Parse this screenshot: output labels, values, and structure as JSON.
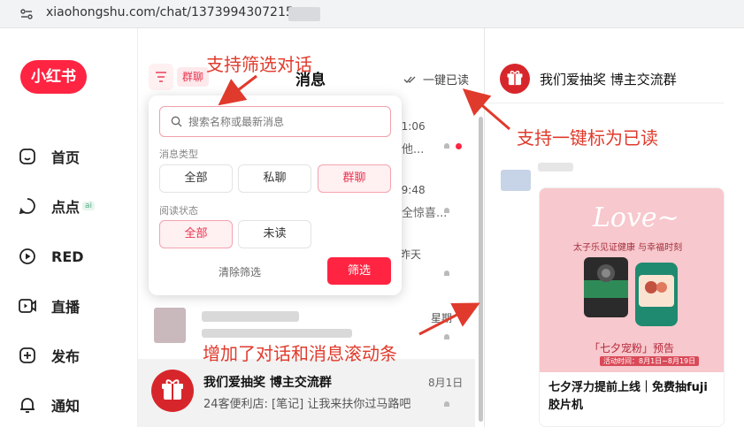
{
  "browser": {
    "url": "xiaohongshu.com/chat/1373994307215"
  },
  "brand": {
    "logo": "小红书",
    "accent": "#ff2442"
  },
  "nav": {
    "items": [
      {
        "label": "首页",
        "icon": "home-icon"
      },
      {
        "label": "点点",
        "icon": "chat-bubble-icon",
        "badge": "ai"
      },
      {
        "label": "RED",
        "icon": "play-icon"
      },
      {
        "label": "直播",
        "icon": "live-icon"
      },
      {
        "label": "发布",
        "icon": "plus-icon"
      },
      {
        "label": "通知",
        "icon": "bell-icon"
      }
    ]
  },
  "messages": {
    "title": "消息",
    "active_filter_chip": "群聊",
    "mark_all_read": "一键已读",
    "rows": [
      {
        "time": "11:06",
        "snippet": "他..."
      },
      {
        "time": "09:48",
        "snippet": "全惊喜..."
      },
      {
        "time": "昨天"
      },
      {
        "time": "星期"
      }
    ],
    "active_chat": {
      "name": "我们爱抽奖 博主交流群",
      "date": "8月1日",
      "preview": "24客便利店: [笔记] 让我来扶你过马路吧"
    }
  },
  "filter": {
    "search_placeholder": "搜索名称或最新消息",
    "type_label": "消息类型",
    "type_options": [
      "全部",
      "私聊",
      "群聊"
    ],
    "type_selected": "群聊",
    "read_label": "阅读状态",
    "read_options": [
      "全部",
      "未读"
    ],
    "read_selected": "全部",
    "clear_label": "清除筛选",
    "apply_label": "筛选"
  },
  "chat": {
    "title": "我们爱抽奖 博主交流群",
    "card": {
      "banner_title": "Love~",
      "banner_subtitle": "太子乐见证健康 与幸福时刻",
      "promo": "「七夕宠粉」预告",
      "promo_date": "活动时间：8月1日~8月19日",
      "caption": "七夕浮力提前上线｜免费抽fuji胶片机"
    }
  },
  "annotations": {
    "filter_note": "支持筛选对话",
    "mark_read_note": "支持一键标为已读",
    "scroll_note": "增加了对话和消息滚动条",
    "color": "#e03a2c"
  }
}
